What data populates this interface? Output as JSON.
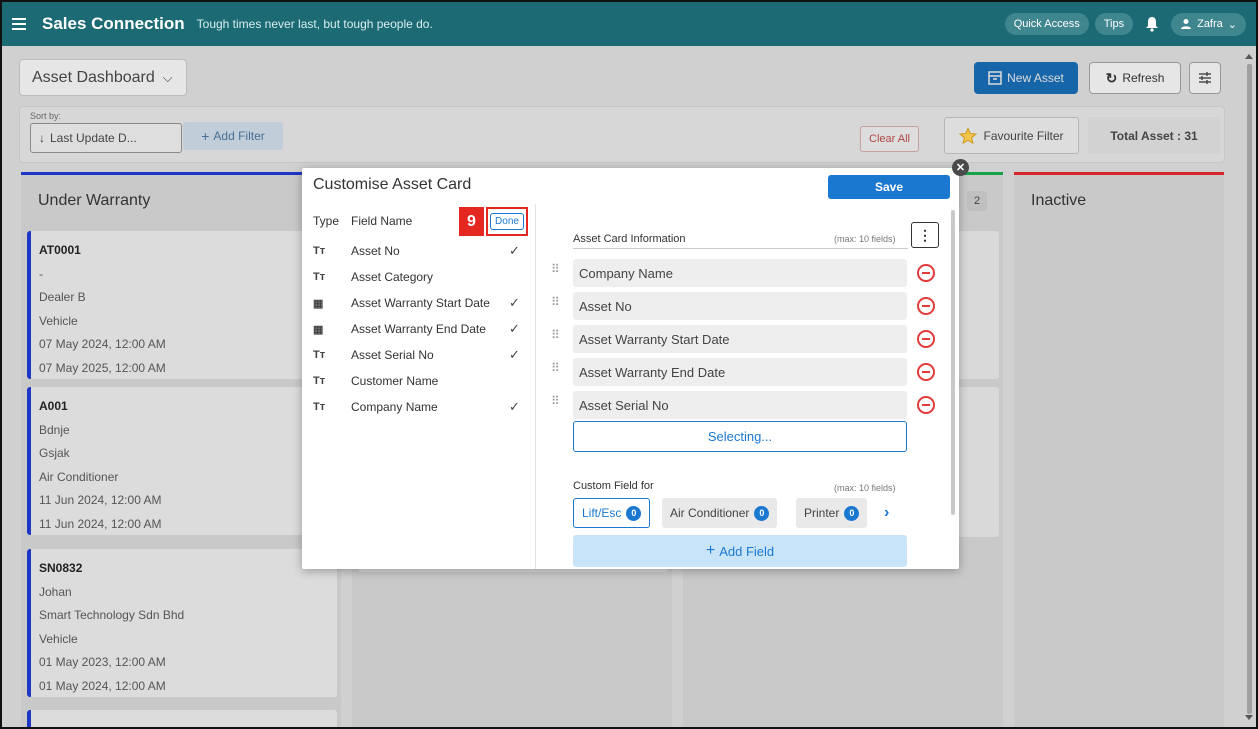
{
  "app": {
    "title": "Sales Connection",
    "tagline": "Tough times never last, but tough people do.",
    "quick_access": "Quick Access",
    "tips": "Tips",
    "user_name": "Zafra"
  },
  "toolbar": {
    "dashboard_name": "Asset Dashboard",
    "new_asset": "New Asset",
    "refresh": "Refresh"
  },
  "filters": {
    "sort_by_label": "Sort by:",
    "sort_value": "Last Update D...",
    "add_filter": "Add Filter",
    "clear_all": "Clear All",
    "favourite_filter": "Favourite Filter",
    "total_asset": "Total Asset : 31"
  },
  "columns": [
    {
      "title": "Under Warranty",
      "accent": "#1d37c4"
    },
    {
      "title": "",
      "count": "2",
      "accent": "#17a24a"
    },
    {
      "title": "Inactive",
      "accent": "#d6262c"
    }
  ],
  "cards": [
    {
      "lines": [
        "AT0001",
        "-",
        "Dealer B",
        "Vehicle",
        "07 May 2024, 12:00 AM",
        "07 May 2025, 12:00 AM"
      ]
    },
    {
      "lines": [
        "A001",
        "Bdnje",
        "Gsjak",
        "Air Conditioner",
        "11 Jun 2024, 12:00 AM",
        "11 Jun 2024, 12:00 AM"
      ]
    },
    {
      "lines": [
        "SN0832",
        "Johan",
        "Smart Technology Sdn Bhd",
        "Vehicle",
        "01 May 2023, 12:00 AM",
        "01 May 2024, 12:00 AM"
      ]
    }
  ],
  "modal": {
    "title": "Customise Asset Card",
    "save": "Save",
    "col_type": "Type",
    "col_field_name": "Field Name",
    "step_number": "9",
    "done": "Done",
    "fields": [
      {
        "icon": "text-type-icon",
        "glyph": "Tт",
        "name": "Asset No",
        "checked": true
      },
      {
        "icon": "text-type-icon",
        "glyph": "Tт",
        "name": "Asset Category",
        "checked": false
      },
      {
        "icon": "calendar-icon",
        "glyph": "▦",
        "name": "Asset Warranty Start Date",
        "checked": true
      },
      {
        "icon": "calendar-icon",
        "glyph": "▦",
        "name": "Asset Warranty End Date",
        "checked": true
      },
      {
        "icon": "text-type-icon",
        "glyph": "Tт",
        "name": "Asset Serial No",
        "checked": true
      },
      {
        "icon": "text-type-icon",
        "glyph": "Tт",
        "name": "Customer Name",
        "checked": false
      },
      {
        "icon": "text-type-icon",
        "glyph": "Tт",
        "name": "Company Name",
        "checked": true
      }
    ],
    "card_info_label": "Asset Card Information",
    "card_info_max": "(max: 10 fields)",
    "card_fields": [
      "Company Name",
      "Asset No",
      "Asset Warranty Start Date",
      "Asset Warranty End Date",
      "Asset Serial No"
    ],
    "selecting": "Selecting...",
    "custom_field_label": "Custom Field for",
    "custom_field_max": "(max: 10 fields)",
    "custom_tabs": [
      {
        "label": "Lift/Esc",
        "count": "0",
        "active": true
      },
      {
        "label": "Air Conditioner",
        "count": "0",
        "active": false
      },
      {
        "label": "Printer",
        "count": "0",
        "active": false
      }
    ],
    "add_field": "Add Field"
  }
}
